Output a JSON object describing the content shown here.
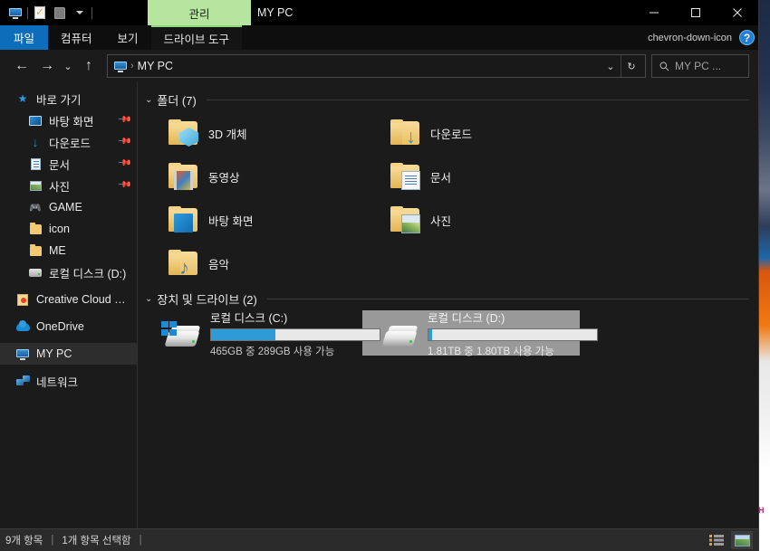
{
  "window": {
    "title": "MY PC",
    "contextual_tab": "관리",
    "controls": {
      "minimize": "minimize-button",
      "maximize": "maximize-button",
      "close": "close-button"
    },
    "quick_access": [
      {
        "name": "this-pc",
        "icon": "monitor-icon"
      },
      {
        "name": "properties",
        "icon": "properties-checkmark-icon"
      },
      {
        "name": "new-folder",
        "icon": "folder-icon"
      },
      {
        "name": "customize",
        "icon": "caret-down-icon"
      }
    ]
  },
  "ribbon": {
    "tabs": [
      {
        "label": "파일",
        "state": "file"
      },
      {
        "label": "컴퓨터",
        "state": "normal"
      },
      {
        "label": "보기",
        "state": "normal"
      },
      {
        "label": "드라이브 도구",
        "state": "contextual"
      }
    ],
    "expand_icon": "chevron-down-icon",
    "help_icon": "?",
    "contextual_color": "#b5e59f",
    "file_tab_color": "#0e6dbb"
  },
  "address": {
    "back": "←",
    "forward": "→",
    "recent": "⌄",
    "up": "↑",
    "crumb_icon": "monitor-icon",
    "crumb_separator": "›",
    "crumb": "MY PC",
    "history_caret": "⌄",
    "refresh": "↻",
    "search_placeholder": "MY PC ...",
    "search_value": "",
    "search_icon": "search-icon"
  },
  "sidebar": {
    "items": [
      {
        "label": "바로 가기",
        "icon": "star-icon",
        "level": 0,
        "pinned": false,
        "selected": false
      },
      {
        "label": "바탕 화면",
        "icon": "desktop-icon",
        "level": 1,
        "pinned": true,
        "selected": false
      },
      {
        "label": "다운로드",
        "icon": "download-icon",
        "level": 1,
        "pinned": true,
        "selected": false
      },
      {
        "label": "문서",
        "icon": "document-icon",
        "level": 1,
        "pinned": true,
        "selected": false
      },
      {
        "label": "사진",
        "icon": "pictures-icon",
        "level": 1,
        "pinned": true,
        "selected": false
      },
      {
        "label": "GAME",
        "icon": "gamepad-icon",
        "level": 1,
        "pinned": false,
        "selected": false
      },
      {
        "label": "icon",
        "icon": "folder-icon",
        "level": 1,
        "pinned": false,
        "selected": false
      },
      {
        "label": "ME",
        "icon": "folder-icon",
        "level": 1,
        "pinned": false,
        "selected": false
      },
      {
        "label": "로컬 디스크 (D:)",
        "icon": "drive-icon",
        "level": 1,
        "pinned": false,
        "selected": false
      },
      {
        "label": "Creative Cloud Files",
        "icon": "creative-cloud-icon",
        "level": 0,
        "pinned": false,
        "selected": false
      },
      {
        "label": "OneDrive",
        "icon": "cloud-icon",
        "level": 0,
        "pinned": false,
        "selected": false
      },
      {
        "label": "MY PC",
        "icon": "monitor-icon",
        "level": 0,
        "pinned": false,
        "selected": true
      },
      {
        "label": "네트워크",
        "icon": "network-icon",
        "level": 0,
        "pinned": false,
        "selected": false
      }
    ]
  },
  "content": {
    "folders_group": {
      "title": "폴더 (7)",
      "chevron": "⌄"
    },
    "folders": [
      {
        "label": "3D 개체",
        "badge": "cube-badge"
      },
      {
        "label": "다운로드",
        "badge": "download-arrow-badge"
      },
      {
        "label": "동영상",
        "badge": "film-badge"
      },
      {
        "label": "문서",
        "badge": "document-badge"
      },
      {
        "label": "바탕 화면",
        "badge": "screen-badge"
      },
      {
        "label": "사진",
        "badge": "photo-badge"
      },
      {
        "label": "음악",
        "badge": "music-note-badge"
      }
    ],
    "drives_group": {
      "title": "장치 및 드라이브 (2)",
      "chevron": "⌄"
    },
    "drives": [
      {
        "name": "로컬 디스크 (C:)",
        "free_text": "465GB 중 289GB 사용 가능",
        "used_percent": 38,
        "bar_color": "#2e9bd6",
        "selected": false,
        "has_windows_logo": true
      },
      {
        "name": "로컬 디스크 (D:)",
        "free_text": "1.81TB 중 1.80TB 사용 가능",
        "used_percent": 2,
        "bar_color": "#2e9bd6",
        "selected": true,
        "has_windows_logo": false
      }
    ]
  },
  "statusbar": {
    "item_count": "9개 항목",
    "divider1": "|",
    "selection": "1개 항목 선택함",
    "divider2": "|",
    "views": [
      {
        "name": "details-view-button",
        "active": false
      },
      {
        "name": "large-icons-view-button",
        "active": true
      }
    ]
  },
  "desktop": {
    "wallpaper_text": "H"
  }
}
